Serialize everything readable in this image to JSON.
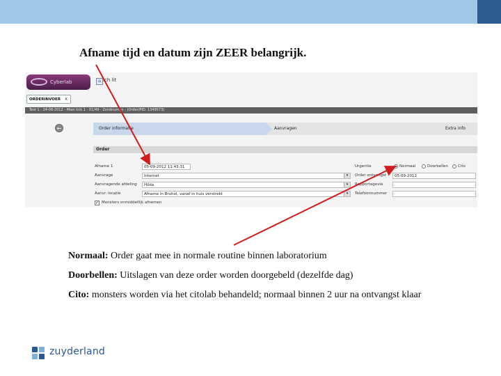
{
  "slide": {
    "title": "Afname tijd en datum zijn ZEER belangrijk."
  },
  "screenshot": {
    "logo_text": "Cyberlab",
    "home_label": "Ich lit",
    "order_tab": {
      "label": "ORDERINVOER",
      "close": "X"
    },
    "breadcrumb": "Test 1 - 24-08-2012 - Mien tick 1 - 01/49 - Zondnuman - (Order/PID: 1349573)",
    "back_symbol": "←",
    "steps": [
      "Order informatie",
      "Aanvragen",
      "Extra info"
    ],
    "section_title": "Order",
    "left_fields": [
      {
        "label": "Afname  1",
        "value": "05-09-2012  11:43:31"
      },
      {
        "label": "Aanvrage",
        "value": "Internet"
      },
      {
        "label": "Aanvragende afdeling",
        "value": "Hilda"
      },
      {
        "label": "Aanvr. locatie",
        "value": "Afname in Bruhol, vanaf in huis verstrekt"
      }
    ],
    "right_fields": [
      {
        "label": "Urgentie"
      },
      {
        "label": "Order ontvangst",
        "value": "05-09-2012"
      },
      {
        "label": "Rapportagevia",
        "value": ""
      },
      {
        "label": "Telefoonnummer",
        "value": ""
      }
    ],
    "urgency_options": [
      "Normaal",
      "Doorbellen",
      "Cito"
    ],
    "urgency_selected": "Normaal",
    "checkbox_label": "Monsters onmiddellijk afnemen",
    "checkbox_checked": true
  },
  "notes": [
    {
      "term": "Normaal:",
      "text": " Order gaat mee in normale routine binnen laboratorium"
    },
    {
      "term": "Doorbellen:",
      "text": " Uitslagen van deze order worden doorgebeld (dezelfde dag)"
    },
    {
      "term": "Cito:",
      "text": " monsters worden via het citolab behandeld; normaal binnen 2 uur na ontvangst klaar"
    }
  ],
  "brand": {
    "name": "zuyderland"
  },
  "colors": {
    "arrow": "#d11c1c",
    "topbar": "#9ec7e8",
    "brand": "#2a5797"
  }
}
